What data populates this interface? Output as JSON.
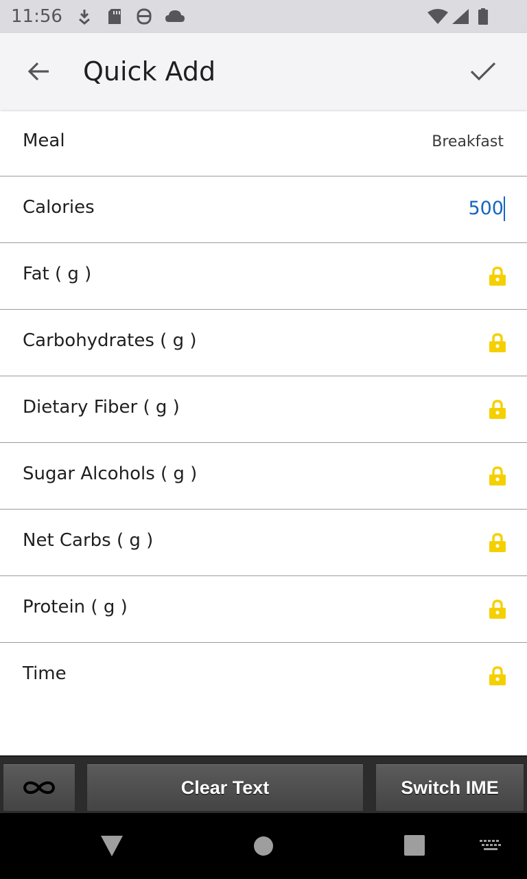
{
  "status_bar": {
    "time": "11:56",
    "icons": [
      "download-icon",
      "sd-card-icon",
      "assistant-icon",
      "cloud-icon",
      "wifi-icon",
      "signal-icon",
      "battery-icon"
    ]
  },
  "app_bar": {
    "title": "Quick Add",
    "back_icon": "arrow-back-icon",
    "confirm_icon": "check-icon"
  },
  "rows": [
    {
      "label": "Meal",
      "value": "Breakfast"
    },
    {
      "label": "Calories",
      "value": "500"
    },
    {
      "label": "Fat ( g )",
      "locked": true
    },
    {
      "label": "Carbohydrates ( g )",
      "locked": true
    },
    {
      "label": "Dietary Fiber ( g )",
      "locked": true
    },
    {
      "label": "Sugar Alcohols ( g )",
      "locked": true
    },
    {
      "label": "Net Carbs ( g )",
      "locked": true
    },
    {
      "label": "Protein ( g )",
      "locked": true
    },
    {
      "label": "Time",
      "locked": true
    }
  ],
  "ime_bar": {
    "infinity_icon": "infinity-icon",
    "clear_label": "Clear Text",
    "switch_label": "Switch IME"
  },
  "colors": {
    "accent": "#1565c0",
    "lock": "#f5d000",
    "app_bar_bg": "#f4f4f6",
    "status_bar_bg": "#dcdce0"
  }
}
